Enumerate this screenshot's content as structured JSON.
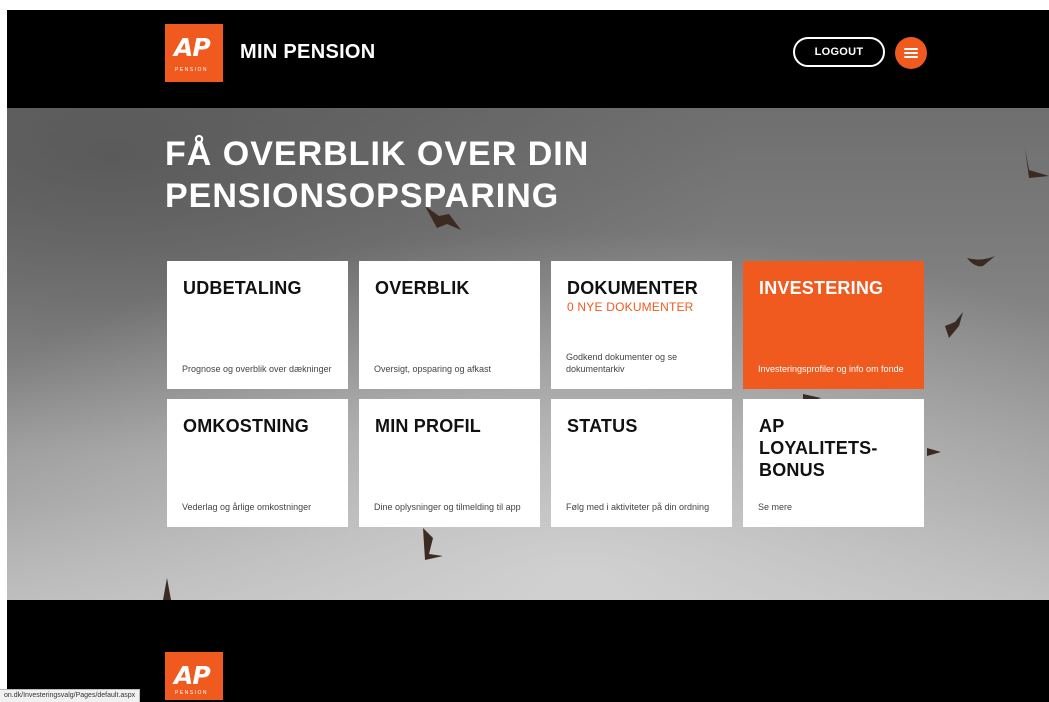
{
  "header": {
    "logo_text": "AP",
    "logo_subtext": "PENSION",
    "title": "MIN PENSION",
    "logout_label": "LOGOUT",
    "menu_icon": "hamburger-menu-icon"
  },
  "hero": {
    "title": "FÅ OVERBLIK OVER DIN PENSIONSOPSPARING"
  },
  "cards": [
    {
      "title": "UDBETALING",
      "subtitle": "",
      "description": "Prognose og overblik over dækninger"
    },
    {
      "title": "OVERBLIK",
      "subtitle": "",
      "description": "Oversigt, opsparing og afkast"
    },
    {
      "title": "DOKUMENTER",
      "subtitle": "0 NYE DOKUMENTER",
      "description": "Godkend dokumenter og se dokumentarkiv"
    },
    {
      "title": "INVESTERING",
      "subtitle": "",
      "description": "Investeringsprofiler og info om fonde"
    },
    {
      "title": "OMKOSTNING",
      "subtitle": "",
      "description": "Vederlag og årlige omkostninger"
    },
    {
      "title": "MIN PROFIL",
      "subtitle": "",
      "description": "Dine oplysninger og tilmelding til app"
    },
    {
      "title": "STATUS",
      "subtitle": "",
      "description": "Følg med i aktiviteter på din ordning"
    },
    {
      "title": "AP LOYALITETS-BONUS",
      "subtitle": "",
      "description": "Se mere"
    }
  ],
  "footer": {
    "logo_text": "AP",
    "logo_subtext": "PENSION"
  },
  "statusbar": {
    "url": "on.dk/Investeringsvalg/Pages/default.aspx"
  },
  "colors": {
    "brand_orange": "#f05a1e",
    "header_bg": "#000000",
    "card_bg": "#ffffff"
  }
}
